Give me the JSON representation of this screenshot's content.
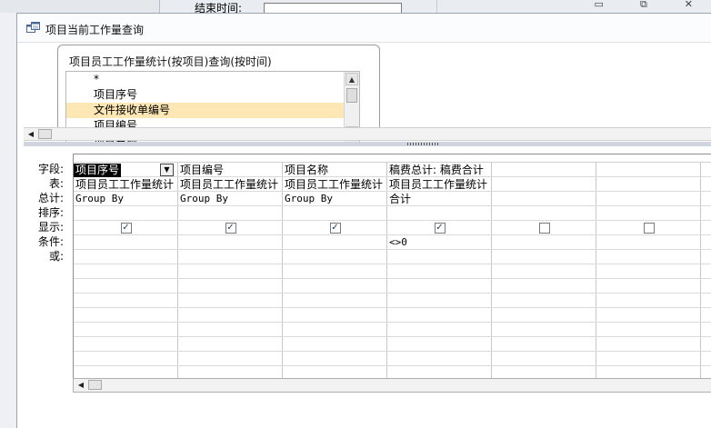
{
  "background": {
    "field_label": "结束时间:",
    "window_controls": [
      "▭",
      "⧉",
      "✕"
    ]
  },
  "window": {
    "title": "项目当前工作量查询"
  },
  "table_box": {
    "title": "项目员工工作量统计(按项目)查询(按时间)",
    "fields": [
      {
        "label": "*",
        "selected": false
      },
      {
        "label": "项目序号",
        "selected": false
      },
      {
        "label": "文件接收单编号",
        "selected": true
      },
      {
        "label": "项目编号",
        "selected": false
      },
      {
        "label": "项目名称",
        "selected": false
      }
    ]
  },
  "grid": {
    "row_labels": [
      "字段:",
      "表:",
      "总计:",
      "排序:",
      "显示:",
      "条件:",
      "或:"
    ],
    "columns": [
      {
        "field": "项目序号",
        "table": "项目员工工作量统计",
        "total": "Group By",
        "sort": "",
        "show": true,
        "criteria": "",
        "active": true
      },
      {
        "field": "项目编号",
        "table": "项目员工工作量统计",
        "total": "Group By",
        "sort": "",
        "show": true,
        "criteria": ""
      },
      {
        "field": "项目名称",
        "table": "项目员工工作量统计",
        "total": "Group By",
        "sort": "",
        "show": true,
        "criteria": ""
      },
      {
        "field": "稿费总计: 稿费合计",
        "table": "项目员工工作量统计",
        "total": "合计",
        "sort": "",
        "show": true,
        "criteria": "<>0"
      },
      {
        "field": "",
        "table": "",
        "total": "",
        "sort": "",
        "show": false,
        "criteria": ""
      },
      {
        "field": "",
        "table": "",
        "total": "",
        "sort": "",
        "show": false,
        "criteria": ""
      }
    ]
  },
  "colors": {
    "selected_field_bg": "#fde8b5",
    "window_border": "#9aa6b6",
    "splitter": "#cfd6e0"
  }
}
